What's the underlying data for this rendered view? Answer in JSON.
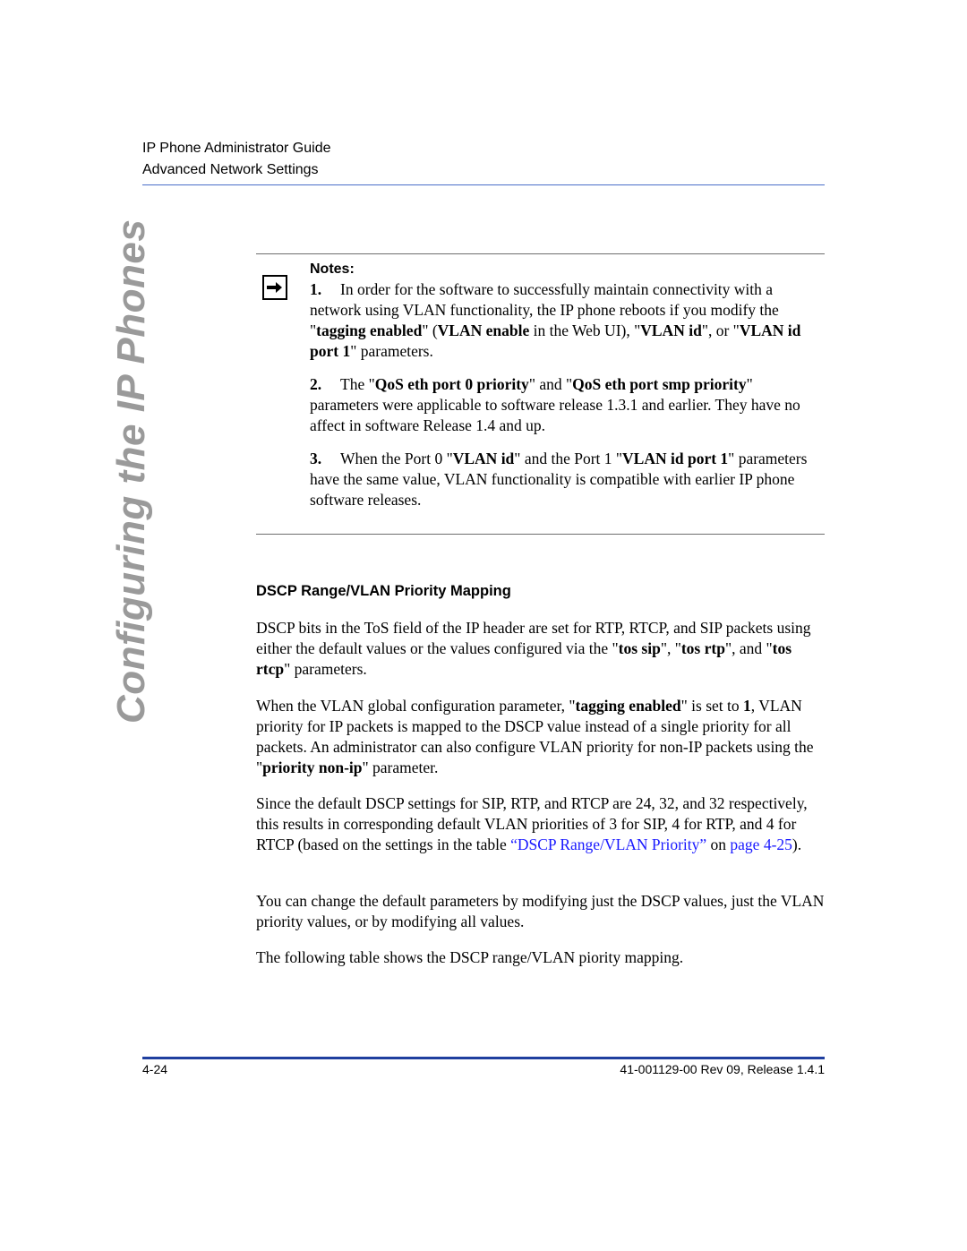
{
  "header": {
    "guide_title": "IP Phone Administrator Guide",
    "section_title": "Advanced Network Settings"
  },
  "side_title": "Configuring the IP Phones",
  "notes": {
    "title": "Notes:",
    "icon": "arrow-right-icon",
    "items": [
      {
        "num": "1.",
        "t1": "In order for the software to successfully maintain connectivity with a network using VLAN functionality, the IP phone reboots if you modify the \"",
        "b1": "tagging enabled",
        "t2": "\" (",
        "b2": "VLAN enable",
        "t3": " in the Web UI), \"",
        "b3": "VLAN id",
        "t4": "\", or \"",
        "b4": "VLAN id port 1",
        "t5": "\" parameters."
      },
      {
        "num": "2.",
        "t1": "The \"",
        "b1": "QoS eth port 0 priority",
        "t2": "\" and \"",
        "b2": "QoS eth port smp priority",
        "t3": "\" parameters were applicable to software release 1.3.1 and earlier.  They have no affect in software Release 1.4 and up."
      },
      {
        "num": "3.",
        "t1": "When the Port 0 \"",
        "b1": "VLAN id",
        "t2": "\" and the Port 1 \"",
        "b2": "VLAN id port 1",
        "t3": "\" parameters have the same value, VLAN functionality is compatible with earlier IP phone software releases."
      }
    ]
  },
  "section": {
    "heading": "DSCP Range/VLAN Priority Mapping",
    "p1": {
      "t1": "DSCP bits in the ToS field of the IP header are set for RTP, RTCP, and SIP packets using either the default values or the values configured via the \"",
      "b1": "tos sip",
      "t2": "\", \"",
      "b2": "tos rtp",
      "t3": "\", and \"",
      "b3": "tos rtcp",
      "t4": "\" parameters."
    },
    "p2": {
      "t1": "When the VLAN global configuration parameter, \"",
      "b1": "tagging enabled",
      "t2": "\" is set to ",
      "b2": "1",
      "t3": ", VLAN priority for IP packets is mapped to the DSCP value instead of a single priority for all packets.  An administrator can also configure VLAN priority for non-IP packets using the \"",
      "b3": "priority non-ip",
      "t4": "\" parameter."
    },
    "p3": {
      "t1": "Since the default DSCP settings for SIP, RTP, and RTCP are 24, 32, and 32 respectively, this results in corresponding default VLAN priorities of 3 for SIP, 4 for RTP, and 4 for RTCP (based on the settings in the table ",
      "link1": "“DSCP Range/VLAN Priority”",
      "t2": " on ",
      "link2": "page 4-25",
      "t3": ")."
    },
    "p4": "You can change the default parameters by modifying just the DSCP values, just the VLAN priority values, or by modifying all values.",
    "p5": "The following table shows the DSCP range/VLAN piority mapping."
  },
  "footer": {
    "page_number": "4-24",
    "doc_id": "41-001129-00 Rev 09, Release 1.4.1"
  },
  "colors": {
    "header_rule": "#4a6fc8",
    "footer_rule": "#1f3f9f",
    "link": "#1a1aff",
    "side_title": "#9a9a9a"
  }
}
